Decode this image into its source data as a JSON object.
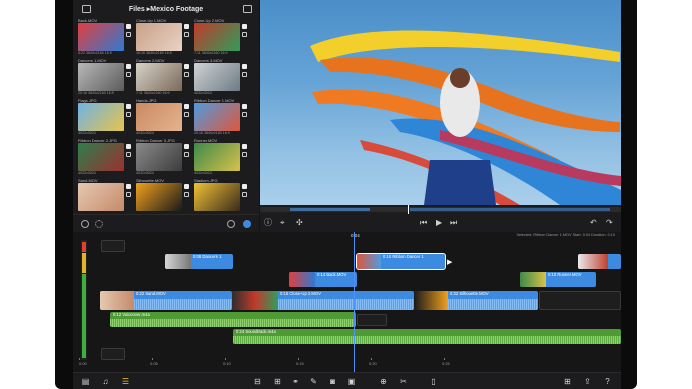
{
  "library": {
    "title": "Files ▸Mexico Footage",
    "clips": [
      {
        "name": "Back.MOV",
        "meta": "5:22  3840x2160  16:9",
        "c1": "#e03f3f",
        "c2": "#2f7ad1"
      },
      {
        "name": "Close-Up 1.MOV",
        "meta": "16:16  3840x2160  16:9",
        "c1": "#c9a187",
        "c2": "#e8d2c5"
      },
      {
        "name": "Close-Up 2.MOV",
        "meta": "7:11  3840x2160  16:9",
        "c1": "#c23a2a",
        "c2": "#2f9d5c"
      },
      {
        "name": "Dancers 1.MOV",
        "meta": "20:16  3840x2160  16:9",
        "c1": "#b8b8b8",
        "c2": "#5c5c5c"
      },
      {
        "name": "Dancers 2.MOV",
        "meta": "7:11  3840x2160  16:9",
        "c1": "#d7d2c8",
        "c2": "#7a6a5a"
      },
      {
        "name": "Dancers 3.MOV",
        "meta": "4032x3024",
        "c1": "#cfd3d6",
        "c2": "#6d7b84"
      },
      {
        "name": "Flags.JPG",
        "meta": "4032x3024",
        "c1": "#6fb3e6",
        "c2": "#e6c44a"
      },
      {
        "name": "Hands.JPG",
        "meta": "4032x3024",
        "c1": "#c98a62",
        "c2": "#e3b48f"
      },
      {
        "name": "Ribbon Dancer 1.MOV",
        "meta": "20:16  3840x2160  16:9",
        "c1": "#4f9be0",
        "c2": "#e0563a"
      },
      {
        "name": "Ribbon Dancer 2.JPG",
        "meta": "4032x3024",
        "c1": "#2e7e4d",
        "c2": "#9a3030"
      },
      {
        "name": "Ribbon Dancer 3.JPG",
        "meta": "4032x3024",
        "c1": "#8a8a8a",
        "c2": "#3c3c3c"
      },
      {
        "name": "Runner.MOV",
        "meta": "4032x3024",
        "c1": "#3e8a4a",
        "c2": "#d8c14a"
      },
      {
        "name": "Sand.MOV",
        "meta": "",
        "c1": "#e5c9b0",
        "c2": "#c58a6b"
      },
      {
        "name": "Silhouette.MOV",
        "meta": "",
        "c1": "#f0a11e",
        "c2": "#1a1a1a"
      },
      {
        "name": "Stadium.JPG",
        "meta": "",
        "c1": "#f0c236",
        "c2": "#3a2a1a"
      }
    ]
  },
  "timeline": {
    "current_time": "0:04",
    "info": "Selected: Ribbon Dancer 1.MOV  Start: 0:04  Duration: 0:10",
    "ruler_labels": [
      "0:00",
      "0:05",
      "0:10",
      "0:15",
      "0:20",
      "0:25"
    ],
    "clips": {
      "c1": "0:08  Dancers 1",
      "c2": "0:10  Ribbon Dancer 1",
      "c3": "0:14  Back.MOV",
      "c4": "0:10  Runner.MOV",
      "c5": "0:22  Sand.MOV",
      "c6": "0:16  Close-Up 2.MOV",
      "c7": "0:32  Silhouette.MOV",
      "c8": "0:12  Voiceover.m4a",
      "c9": "0:24  Soundtrack.m4a"
    }
  },
  "colors": {
    "accent": "#f2c12e",
    "video_clip": "#3d8be0",
    "audio_clip": "#4f9a35",
    "playhead": "#4f8ff7"
  }
}
